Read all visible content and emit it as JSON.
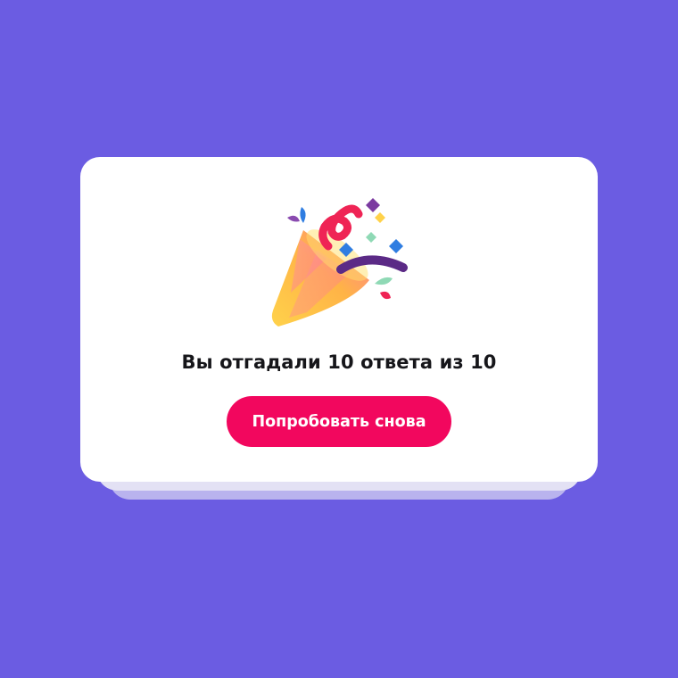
{
  "quiz_result": {
    "icon": "party-popper-icon",
    "result_text": "Вы отгадали 10 ответа из 10",
    "retry_label": "Попробовать снова"
  },
  "colors": {
    "background": "#6b5ce2",
    "card": "#ffffff",
    "accent": "#f2075e"
  }
}
